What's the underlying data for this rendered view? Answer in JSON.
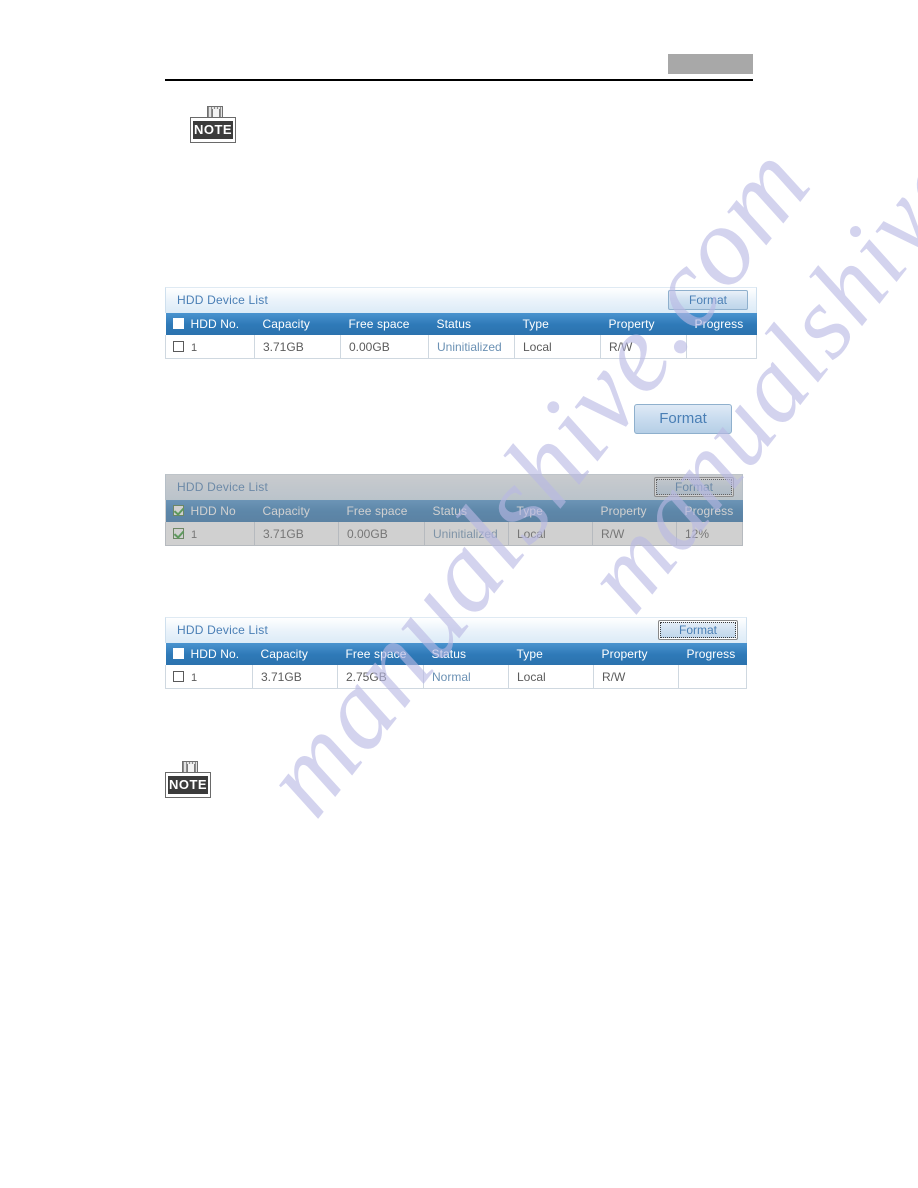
{
  "page": {
    "header": {
      "redaction_present": true
    },
    "watermark": {
      "line1": "manualshive.com",
      "line2": "manualshive.com",
      "color": "#b9b9e4"
    },
    "note_icons": [
      {
        "label": "NOTE"
      },
      {
        "label": "NOTE"
      }
    ]
  },
  "colors": {
    "table_header_blue": "#2f7ab8",
    "panel_title_text": "#4a7fb5",
    "cell_text": "#5b5b5b",
    "status_text": "#6b91b4",
    "check_green": "#2e9b2e",
    "redaction_grey": "#a8a8a8"
  },
  "standalone_button": {
    "label": "Format"
  },
  "columns": [
    "HDD No.",
    "Capacity",
    "Free space",
    "Status",
    "Type",
    "Property",
    "Progress"
  ],
  "panels": [
    {
      "title": "HDD Device List",
      "button_label": "Format",
      "button_state": "normal",
      "state": "enabled",
      "header_checked": false,
      "rows": [
        {
          "checked": false,
          "no": "1",
          "capacity": "3.71GB",
          "free_space": "0.00GB",
          "status": "Uninitialized",
          "type": "Local",
          "property": "R/W",
          "progress": ""
        }
      ]
    },
    {
      "title": "HDD Device List",
      "button_label": "Format",
      "button_state": "focused",
      "state": "disabled",
      "header_checked": true,
      "columns": [
        "HDD No",
        "Capacity",
        "Free space",
        "Status",
        "Type",
        "Property",
        "Progress"
      ],
      "rows": [
        {
          "checked": true,
          "no": "1",
          "capacity": "3.71GB",
          "free_space": "0.00GB",
          "status": "Uninitialized",
          "type": "Local",
          "property": "R/W",
          "progress": "12%"
        }
      ]
    },
    {
      "title": "HDD Device List",
      "button_label": "Format",
      "button_state": "focused",
      "state": "enabled",
      "header_checked": false,
      "rows": [
        {
          "checked": false,
          "no": "1",
          "capacity": "3.71GB",
          "free_space": "2.75GB",
          "status": "Normal",
          "type": "Local",
          "property": "R/W",
          "progress": ""
        }
      ]
    }
  ]
}
